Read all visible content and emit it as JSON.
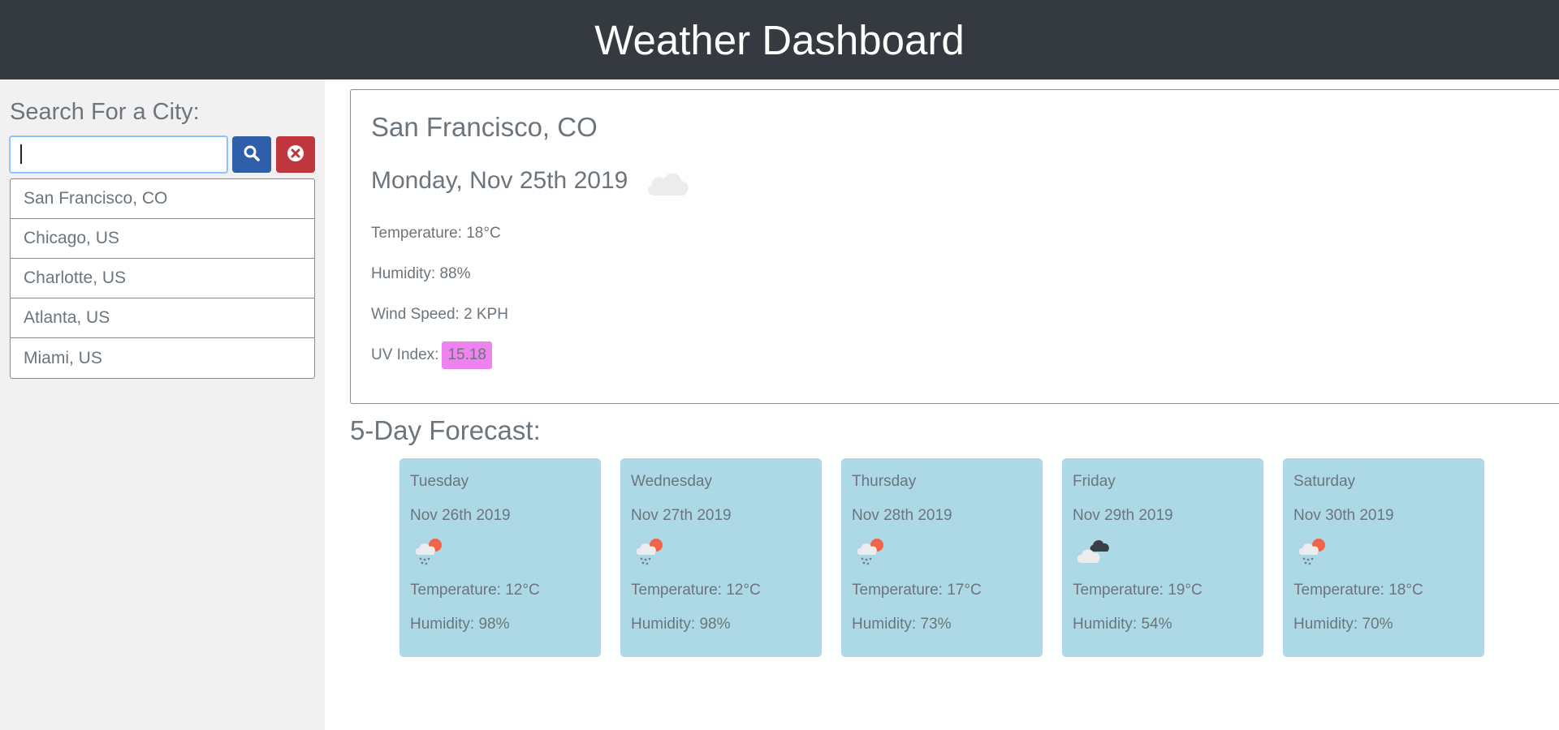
{
  "header": {
    "title": "Weather Dashboard"
  },
  "sidebar": {
    "search_label": "Search For a City:",
    "search_value": "",
    "search_button_icon": "search-icon",
    "clear_button_icon": "close-circle-icon",
    "cities": [
      "San Francisco, CO",
      "Chicago, US",
      "Charlotte, US",
      "Atlanta, US",
      "Miami, US"
    ]
  },
  "current": {
    "city": "San Francisco, CO",
    "date": "Monday, Nov 25th 2019",
    "icon": "cloud-icon",
    "temperature_label": "Temperature: 18°C",
    "humidity_label": "Humidity: 88%",
    "wind_label": "Wind Speed: 2 KPH",
    "uv_label": "UV Index:",
    "uv_value": "15.18",
    "uv_color": "#ee82ee"
  },
  "forecast": {
    "title": "5-Day Forecast:",
    "days": [
      {
        "day": "Tuesday",
        "date": "Nov 26th 2019",
        "icon": "sun-rain-cloud-icon",
        "temp": "Temperature: 12°C",
        "humidity": "Humidity: 98%"
      },
      {
        "day": "Wednesday",
        "date": "Nov 27th 2019",
        "icon": "sun-rain-cloud-icon",
        "temp": "Temperature: 12°C",
        "humidity": "Humidity: 98%"
      },
      {
        "day": "Thursday",
        "date": "Nov 28th 2019",
        "icon": "sun-rain-cloud-icon",
        "temp": "Temperature: 17°C",
        "humidity": "Humidity: 73%"
      },
      {
        "day": "Friday",
        "date": "Nov 29th 2019",
        "icon": "broken-clouds-icon",
        "temp": "Temperature: 19°C",
        "humidity": "Humidity: 54%"
      },
      {
        "day": "Saturday",
        "date": "Nov 30th 2019",
        "icon": "sun-rain-cloud-icon",
        "temp": "Temperature: 18°C",
        "humidity": "Humidity: 70%"
      }
    ]
  },
  "colors": {
    "header_bg": "#343a40",
    "search_button": "#2e5fa8",
    "clear_button": "#c0363f",
    "forecast_card": "#add8e6"
  }
}
